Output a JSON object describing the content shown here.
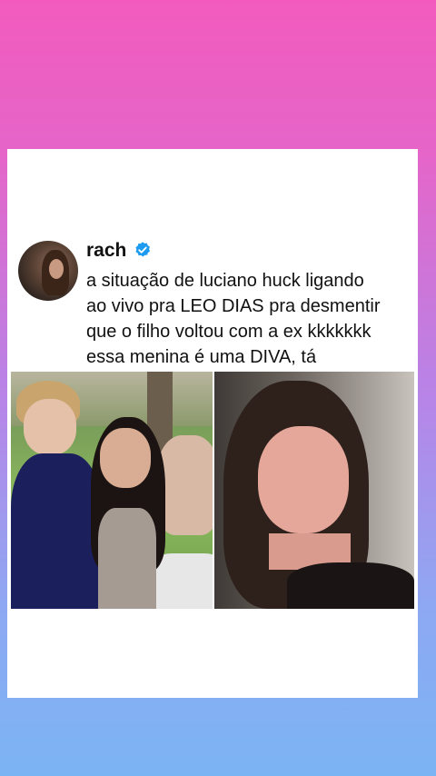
{
  "post": {
    "username": "rach",
    "text_lines": [
      "a situação de luciano huck ligando",
      "ao vivo pra LEO DIAS pra desmentir",
      "que o filho voltou com a ex kkkkkkk",
      "essa menina é uma DIVA, tá"
    ]
  },
  "icons": {
    "verified": "verified-badge-icon"
  },
  "colors": {
    "verified_blue": "#1d9bf0",
    "card_background": "#ffffff",
    "gradient_top": "#f25bbd",
    "gradient_bottom": "#7bb4f3"
  },
  "images": {
    "left": "selfie-three-people-garden",
    "right": "portrait-young-woman"
  }
}
